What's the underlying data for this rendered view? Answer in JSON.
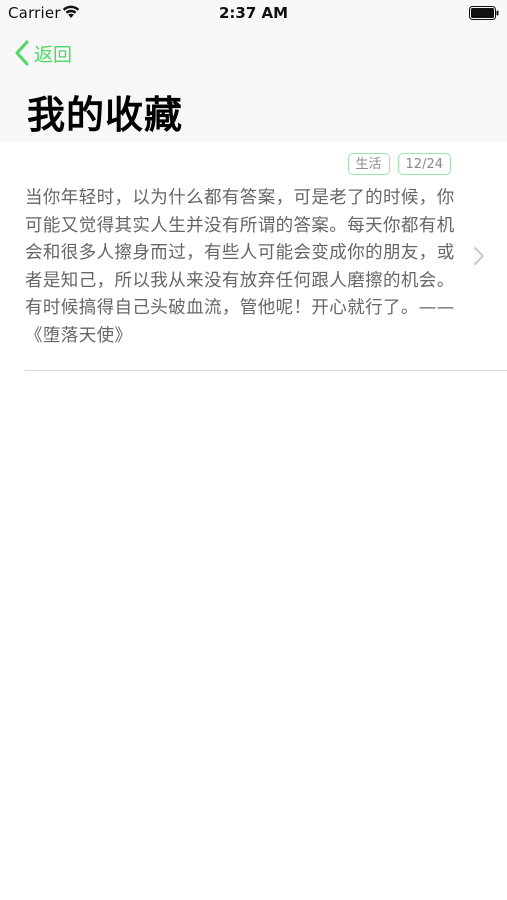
{
  "status_bar": {
    "carrier": "Carrier",
    "time": "2:37 AM",
    "icons": [
      "wifi-icon",
      "battery-icon"
    ]
  },
  "nav": {
    "back_label": "返回",
    "back_icon": "chevron-left-icon",
    "title": "我的收藏",
    "accent_color": "#4cd964"
  },
  "favorites": [
    {
      "tags": [
        "生活",
        "12/24"
      ],
      "text": "当你年轻时，以为什么都有答案，可是老了的时候，你可能又觉得其实人生并没有所谓的答案。每天你都有机会和很多人擦身而过，有些人可能会变成你的朋友，或者是知己，所以我从来没有放弃任何跟人磨擦的机会。有时候搞得自己头破血流，管他呢！开心就行了。——《堕落天使》",
      "icon": "chevron-right-icon"
    }
  ]
}
